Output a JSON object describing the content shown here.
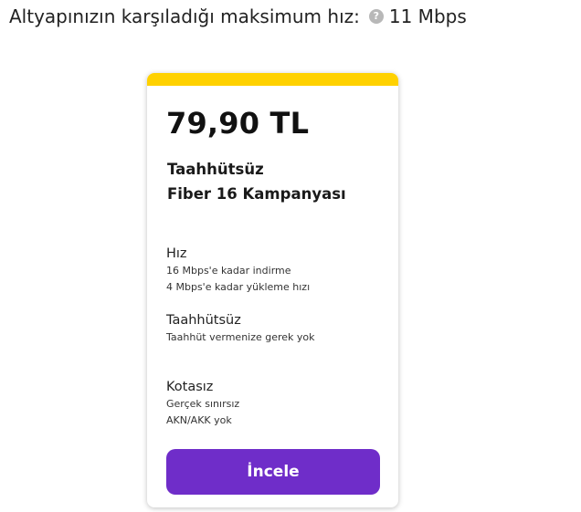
{
  "header": {
    "label": "Altyapınızın karşıladığı maksimum hız:",
    "help_icon": "question-circle-icon",
    "help_glyph": "?",
    "speed": "11 Mbps"
  },
  "card": {
    "accent_color": "#ffd100",
    "price": "79,90 TL",
    "plan_name_line1": "Taahhütsüz",
    "plan_name_line2": "Fiber 16 Kampanyası",
    "features": [
      {
        "title": "Hız",
        "lines": [
          "16 Mbps'e kadar indirme",
          "4 Mbps'e kadar yükleme hızı"
        ]
      },
      {
        "title": "Taahhütsüz",
        "lines": [
          "Taahhüt vermenize gerek yok"
        ]
      },
      {
        "title": "Kotasız",
        "lines": [
          "Gerçek sınırsız",
          "AKN/AKK yok"
        ]
      }
    ],
    "button_label": "İncele",
    "button_color": "#6f2dc9"
  }
}
